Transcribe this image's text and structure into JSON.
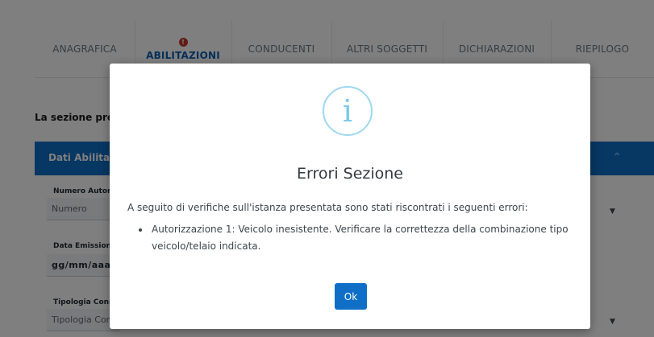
{
  "tabs": [
    {
      "label": "ANAGRAFICA",
      "active": false
    },
    {
      "label": "ABILITAZIONI",
      "active": true,
      "error_badge": "!"
    },
    {
      "label": "CONDUCENTI",
      "active": false
    },
    {
      "label": "ALTRI SOGGETTI",
      "active": false
    },
    {
      "label": "DICHIARAZIONI",
      "active": false
    },
    {
      "label": "RIEPILOGO",
      "active": false
    }
  ],
  "intro_text": "La sezione presen",
  "section": {
    "title": "Dati Abilitazion",
    "toggle_icon": "chevron-up-icon"
  },
  "fields": {
    "numero_autorizzazione": {
      "label": "Numero Autoriz",
      "placeholder": "Numero Autoriz"
    },
    "data_emissione": {
      "label": "Data Emissione",
      "value": "gg/mm/aaaa"
    },
    "tipologia": {
      "label": "Tipologia Conseg",
      "placeholder": "Tipologia Con"
    }
  },
  "modal": {
    "icon": "info-icon",
    "icon_glyph": "i",
    "title": "Errori Sezione",
    "message": "A seguito di verifiche sull'istanza presentata sono stati riscontrati i seguenti errori:",
    "errors": [
      "Autorizzazione 1: Veicolo inesistente. Verificare la correttezza della combinazione tipo veicolo/telaio indicata."
    ],
    "ok_label": "Ok"
  },
  "colors": {
    "primary": "#0f6fc6",
    "error": "#c0392b",
    "info": "#9ed8ef"
  }
}
